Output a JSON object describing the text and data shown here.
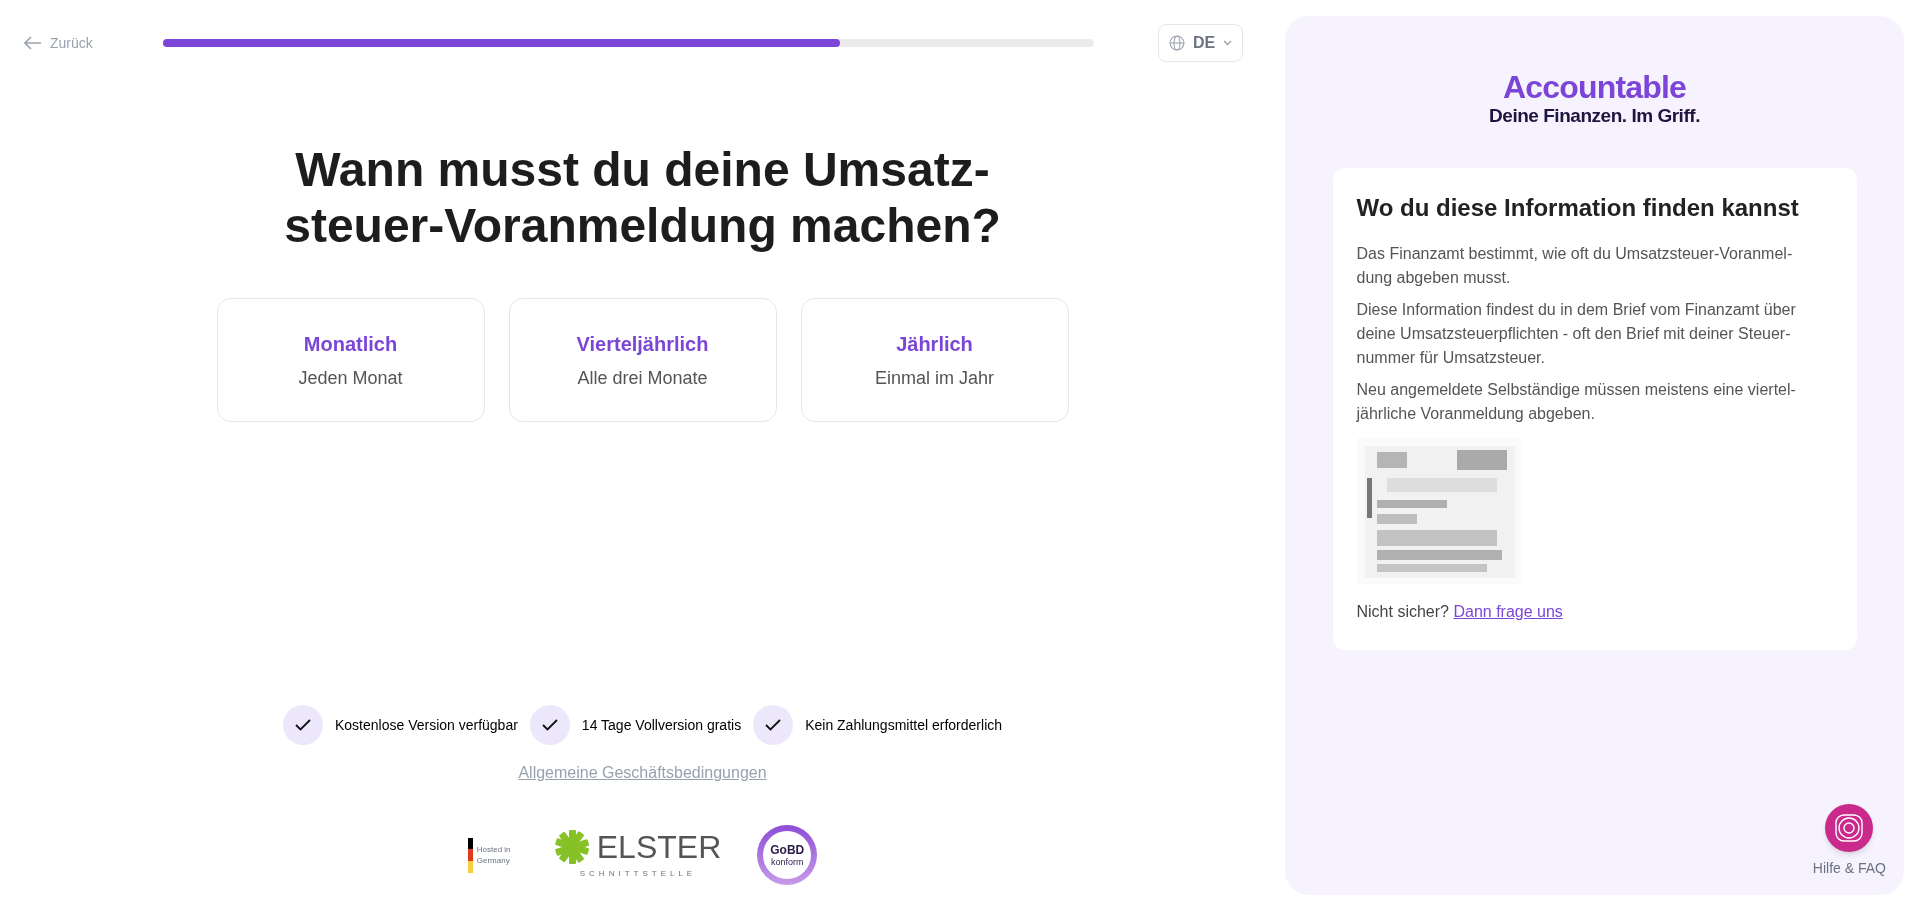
{
  "header": {
    "back_label": "Zurück",
    "progress": {
      "level": 0.727
    },
    "language": "DE"
  },
  "question": "Wann musst du deine Umsatz-steuer-Voranmeldung machen?",
  "options": [
    {
      "title": "Monatlich",
      "subtitle": "Jeden Monat",
      "selected": false
    },
    {
      "title": "Vierteljährlich",
      "subtitle": "Alle drei Monate",
      "selected": false
    },
    {
      "title": "Jährlich",
      "subtitle": "Einmal im Jahr",
      "selected": false
    }
  ],
  "benefits": [
    "Kostenlose Version verfügbar",
    "14 Tage Vollversion gratis",
    "Kein Zahlungsmittel erforderlich"
  ],
  "terms_link": "Allgemeine Geschäftsbedingungen",
  "badges": {
    "hosted": "Hosted in Germany",
    "elster": "ELSTER",
    "elster_sub": "SCHNITTSTELLE",
    "gobd": "GoBD",
    "gobd_sub": "konform"
  },
  "sidebar": {
    "brand": "Accountable",
    "tagline": "Deine Finanzen. Im Griff.",
    "info": {
      "title": "Wo du diese Information finden kannst",
      "paragraphs": [
        "Das Finanzamt bestimmt, wie oft du Umsatzsteuer-Voranmel-dung abgeben musst.",
        "Diese Information findest du in dem Brief vom Finanzamt über deine Umsatzsteuerpflichten - oft den Brief mit deiner Steuer-nummer für Umsatzsteuer.",
        "Neu angemeldete Selbständige müssen meistens eine viertel-jährliche Voranmeldung abgeben."
      ],
      "unsure": "Nicht sicher?",
      "ask_link": "Dann frage uns"
    },
    "help_label": "Hilfe & FAQ"
  }
}
